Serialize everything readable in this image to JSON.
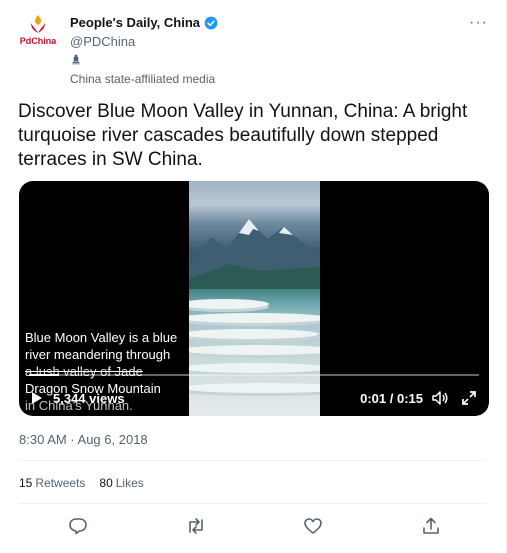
{
  "tweet": {
    "author": {
      "name": "People's Daily, China",
      "handle": "@PDChina",
      "verified": true,
      "avatar_text": "PdChina",
      "label": "China state-affiliated media"
    },
    "text": "Discover Blue Moon Valley in Yunnan, China: A bright turquoise river cascades beautifully down stepped terraces in SW China.",
    "video": {
      "caption_line1": "Blue Moon Valley is a blue",
      "caption_line2": "river meandering through",
      "caption_line3": "a lush valley of Jade",
      "caption_line4": "Dragon Snow Mountain",
      "caption_line5": "in China's Yunnan.",
      "views": "5,344 views",
      "time": "0:01 / 0:15",
      "progress": 0.067
    },
    "timestamp": "8:30 AM · Aug 6, 2018",
    "stats": {
      "retweets_count": "15",
      "retweets_label": "Retweets",
      "likes_count": "80",
      "likes_label": "Likes"
    },
    "icons": {
      "more": "more-icon",
      "verified": "verified-badge-icon",
      "state_media": "state-media-icon",
      "reply": "reply-icon",
      "retweet": "retweet-icon",
      "like": "like-icon",
      "share": "share-icon",
      "play": "play-icon",
      "volume": "volume-icon",
      "fullscreen": "fullscreen-icon"
    },
    "colors": {
      "brand_red": "#c8102e",
      "verified_blue": "#1d9bf0",
      "secondary_text": "#536471"
    }
  }
}
